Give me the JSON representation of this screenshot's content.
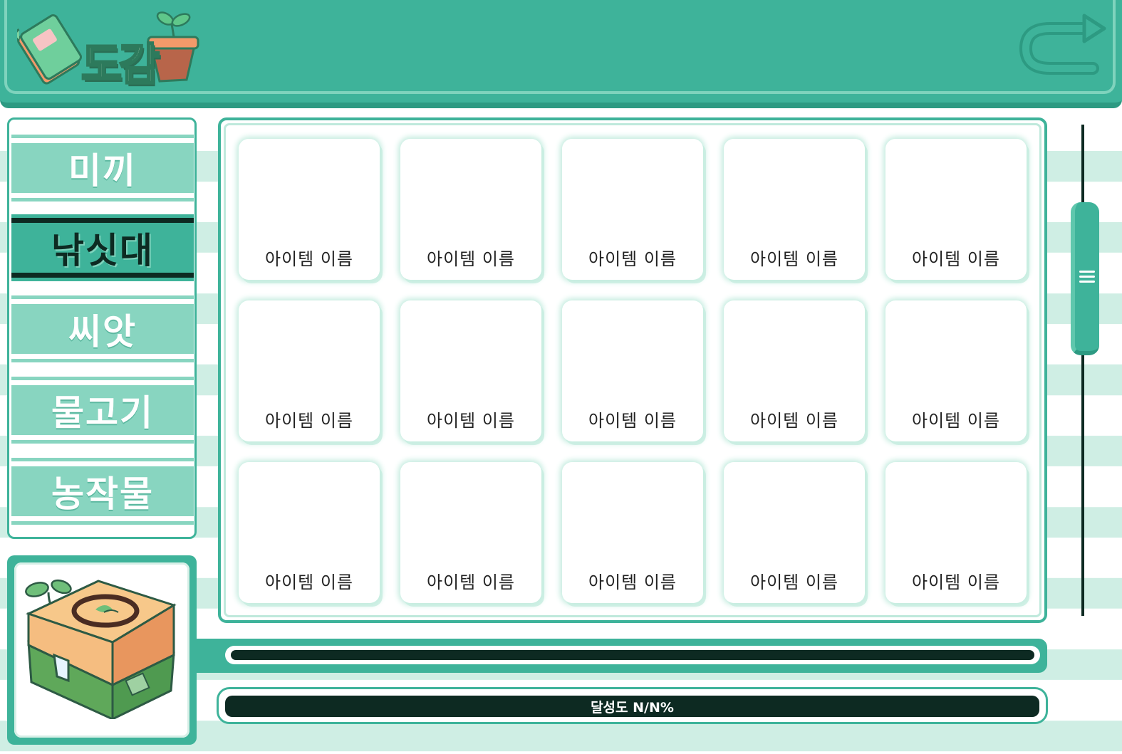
{
  "header": {
    "title": "도감",
    "back_icon": "return-arrow-icon"
  },
  "categories": [
    {
      "label": "미끼",
      "active": false
    },
    {
      "label": "낚싯대",
      "active": true
    },
    {
      "label": "씨앗",
      "active": false
    },
    {
      "label": "물고기",
      "active": false
    },
    {
      "label": "농작물",
      "active": false
    }
  ],
  "items": [
    {
      "label": "아이템 이름"
    },
    {
      "label": "아이템 이름"
    },
    {
      "label": "아이템 이름"
    },
    {
      "label": "아이템 이름"
    },
    {
      "label": "아이템 이름"
    },
    {
      "label": "아이템 이름"
    },
    {
      "label": "아이템 이름"
    },
    {
      "label": "아이템 이름"
    },
    {
      "label": "아이템 이름"
    },
    {
      "label": "아이템 이름"
    },
    {
      "label": "아이템 이름"
    },
    {
      "label": "아이템 이름"
    },
    {
      "label": "아이템 이름"
    },
    {
      "label": "아이템 이름"
    },
    {
      "label": "아이템 이름"
    }
  ],
  "progress": {
    "label": "달성도 N/N%"
  },
  "colors": {
    "primary": "#3eb39a",
    "light": "#88d5c0",
    "dark": "#0d2a22",
    "stripe": "#cfeee4"
  }
}
